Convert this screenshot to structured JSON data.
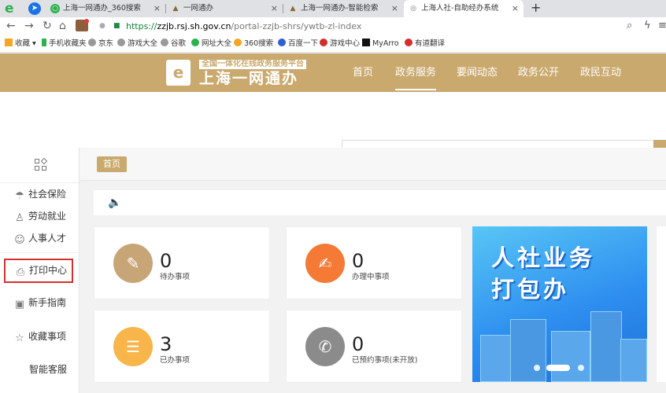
{
  "browser": {
    "tabs": [
      {
        "title": "上海一网通办_360搜索",
        "active": false
      },
      {
        "title": "一网通办",
        "active": false
      },
      {
        "title": "上海一网通办-智能检索",
        "active": false
      },
      {
        "title": "上海人社-自助经办系统",
        "active": true
      }
    ],
    "tab_close_glyph": "×",
    "new_tab_glyph": "+",
    "url_proto": "https://",
    "url_host": "zzjb.rsj.sh.gov.cn",
    "url_path": "/portal-zzjb-shrs/ywtb-zl-index",
    "bookmarks": [
      "收藏",
      "手机收藏夹",
      "京东",
      "游戏大全",
      "谷歌",
      "网址大全",
      "360搜索",
      "百度一下",
      "游戏中心",
      "MyArro",
      "有道翻译"
    ]
  },
  "site": {
    "logo_glyph": "e",
    "logo_subtitle": "全国一体化在线政务服务平台",
    "logo_title": "上海一网通办",
    "nav": [
      "首页",
      "政务服务",
      "要闻动态",
      "政务公开",
      "政民互动"
    ],
    "active_nav": "政务服务"
  },
  "sidebar": {
    "items": [
      {
        "label": "社会保险",
        "icon": "umbrella-icon"
      },
      {
        "label": "劳动就业",
        "icon": "worker-icon"
      },
      {
        "label": "人事人才",
        "icon": "people-icon"
      },
      {
        "label": "打印中心",
        "icon": "printer-icon",
        "highlighted": true
      },
      {
        "label": "新手指南",
        "icon": "guide-icon"
      },
      {
        "label": "收藏事项",
        "icon": "star-icon"
      },
      {
        "label": "智能客服",
        "icon": ""
      }
    ]
  },
  "main": {
    "breadcrumb": "首页",
    "cards": [
      {
        "count": "0",
        "label": "待办事项",
        "color": "#c8a577",
        "icon": "document-icon"
      },
      {
        "count": "0",
        "label": "办理中事项",
        "color": "#f47a35",
        "icon": "edit-document-icon"
      },
      {
        "count": "3",
        "label": "已办事项",
        "color": "#f8b54a",
        "icon": "document-list-icon"
      },
      {
        "count": "0",
        "label": "已预约事项(未开放)",
        "color": "#8b8b8b",
        "icon": "phone-icon"
      }
    ],
    "banner_lines": [
      "人社业务",
      "打包办"
    ]
  },
  "colors": {
    "brand": "#c9a96e",
    "highlight_border": "#d32f2f"
  }
}
